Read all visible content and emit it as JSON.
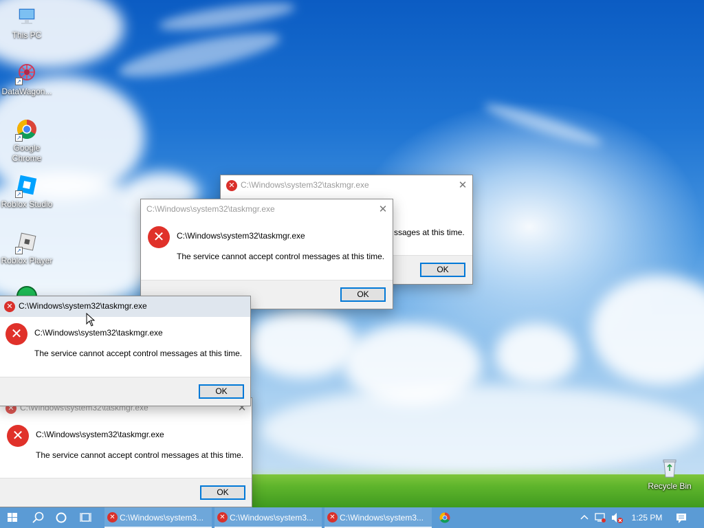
{
  "desktop": {
    "icons": [
      {
        "label": "This PC",
        "icon": "computer-icon"
      },
      {
        "label": "DataWagon...",
        "icon": "datawagon-icon"
      },
      {
        "label": "Google Chrome",
        "icon": "chrome-icon"
      },
      {
        "label": "Roblox Studio",
        "icon": "roblox-studio-icon"
      },
      {
        "label": "Roblox Player",
        "icon": "roblox-player-icon"
      },
      {
        "label": "Recycle Bin",
        "icon": "recycle-bin-icon"
      }
    ]
  },
  "dialogs": [
    {
      "title": "C:\\Windows\\system32\\taskmgr.exe",
      "heading": "C:\\Windows\\system32\\taskmgr.exe",
      "message": "The service cannot accept control messages at this time.",
      "message_visible": "ssages at this time.",
      "ok_label": "OK"
    },
    {
      "title": "C:\\Windows\\system32\\taskmgr.exe",
      "heading": "C:\\Windows\\system32\\taskmgr.exe",
      "message": "The service cannot accept control messages at this time.",
      "ok_label": "OK"
    },
    {
      "title": "C:\\Windows\\system32\\taskmgr.exe",
      "heading": "C:\\Windows\\system32\\taskmgr.exe",
      "message": "The service cannot accept control messages at this time.",
      "ok_label": "OK"
    },
    {
      "title": "C:\\Windows\\system32\\taskmgr.exe",
      "heading": "C:\\Windows\\system32\\taskmgr.exe",
      "message": "The service cannot accept control messages at this time.",
      "ok_label": "OK"
    }
  ],
  "taskbar": {
    "start_icon": "windows-start-icon",
    "search_icon": "search-icon",
    "cortana_icon": "cortana-circle-icon",
    "task_view_icon": "task-view-icon",
    "tasks": [
      {
        "label": "C:\\Windows\\system3...",
        "icon": "error-icon"
      },
      {
        "label": "C:\\Windows\\system3...",
        "icon": "error-icon"
      },
      {
        "label": "C:\\Windows\\system3...",
        "icon": "error-icon"
      }
    ],
    "pinned": [
      {
        "icon": "chrome-icon"
      }
    ],
    "tray": {
      "chevron_icon": "chevron-up-icon",
      "network_icon": "network-icon",
      "volume_icon": "volume-muted-icon",
      "time": "1:25 PM",
      "notification_icon": "action-center-icon"
    }
  },
  "colors": {
    "taskbar": "#5b9bd5",
    "accent_blue": "#0078d7",
    "error_red": "#e0312a",
    "dialog_footer": "#f0f0f0"
  }
}
